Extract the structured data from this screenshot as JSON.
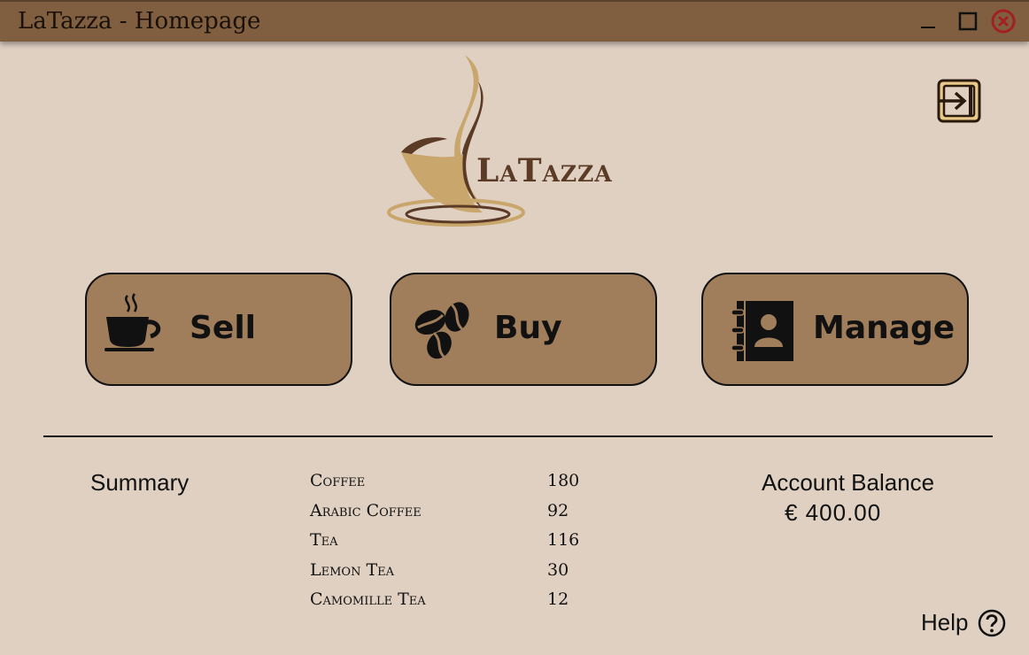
{
  "window": {
    "title": "LaTazza - Homepage"
  },
  "logo": {
    "text": "LaTazza"
  },
  "buttons": {
    "sell_label": "Sell",
    "buy_label": "Buy",
    "manage_label": "Manage"
  },
  "summary": {
    "label": "Summary",
    "items": [
      {
        "name": "Coffee",
        "count": "180"
      },
      {
        "name": "Arabic Coffee",
        "count": "92"
      },
      {
        "name": "Tea",
        "count": "116"
      },
      {
        "name": "Lemon Tea",
        "count": "30"
      },
      {
        "name": "Camomille Tea",
        "count": "12"
      }
    ]
  },
  "account": {
    "label": "Account Balance",
    "value": "€ 400.00"
  },
  "help": {
    "label": "Help"
  },
  "icons": {
    "minimize": "minimize-icon",
    "maximize": "maximize-icon",
    "close": "close-icon",
    "logout": "logout-icon",
    "sell": "coffee-cup-icon",
    "buy": "coffee-beans-icon",
    "manage": "address-book-icon",
    "help": "help-icon"
  },
  "colors": {
    "titlebar": "#7f5f40",
    "background": "#dfd0c2",
    "button": "#a07d5b",
    "logo_brown": "#5b3a26",
    "logo_gold": "#c9a66b",
    "close_red": "#a32020"
  }
}
